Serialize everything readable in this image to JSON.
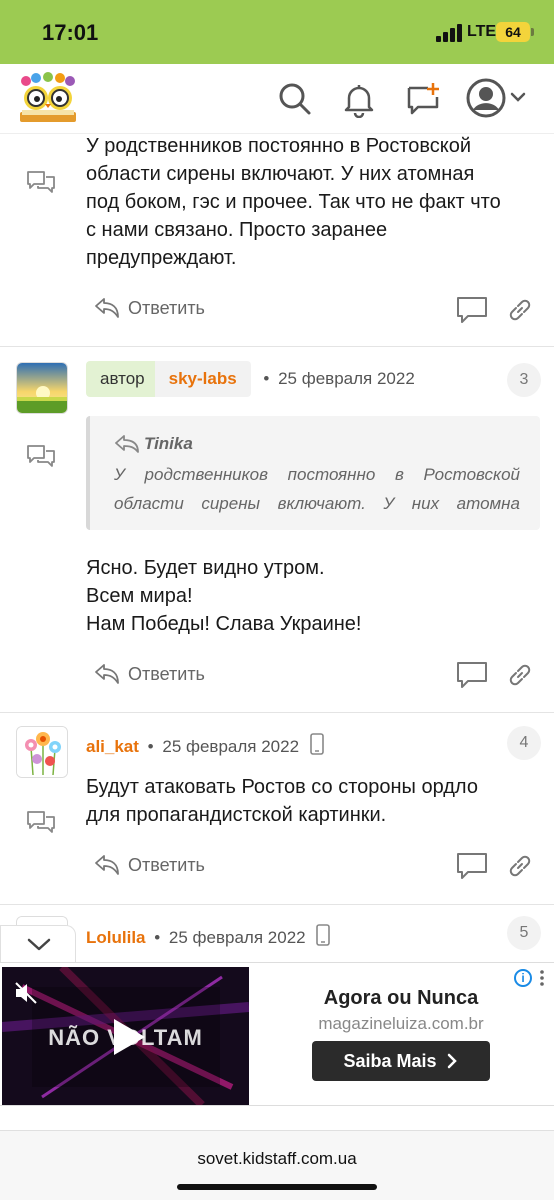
{
  "status_bar": {
    "time": "17:01",
    "network": "LTE",
    "battery": "64"
  },
  "header": {
    "logo_alt": "Kidstaff owl logo"
  },
  "comments": [
    {
      "text_lines": [
        "У родственников постоянно в Ростовской",
        "области сирены включают. У них атомная",
        "под боком, гэс и прочее. Так что не факт что",
        "с нами связано. Просто заранее",
        "предупреждают."
      ],
      "reply_label": "Ответить"
    },
    {
      "author_badge": "автор",
      "author": "sky-labs",
      "separator": "•",
      "date": "25 февраля 2022",
      "number": "3",
      "quote": {
        "author": "Tinika",
        "text": "У родственников постоянно в Ростовской области сирены включают. У них атомна"
      },
      "text_lines": [
        "Ясно. Будет видно утром.",
        "Всем мира!",
        "Нам Победы! Слава Украине!"
      ],
      "reply_label": "Ответить"
    },
    {
      "author": "ali_kat",
      "separator": "•",
      "date": "25 февраля 2022",
      "number": "4",
      "text_lines": [
        "Будут атаковать Ростов со стороны ордло",
        "для пропагандистской картинки."
      ],
      "reply_label": "Ответить"
    },
    {
      "author": "Lolulila",
      "separator": "•",
      "date": "25 февраля 2022",
      "number": "5"
    }
  ],
  "ad": {
    "video_text": "NÃO VOLTAM",
    "title": "Agora ou Nunca",
    "domain": "magazineluiza.com.br",
    "button_label": "Saiba Mais",
    "info": "i"
  },
  "browser": {
    "url": "sovet.kidstaff.com.ua"
  },
  "colors": {
    "status_bar": "#9ccb52",
    "author": "#e8730c",
    "author_badge_bg": "#e3f2d3"
  }
}
